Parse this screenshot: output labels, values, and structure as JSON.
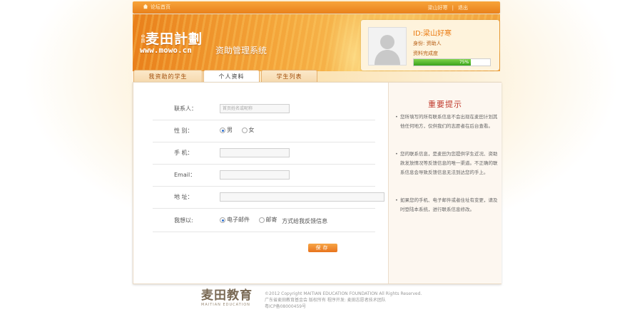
{
  "topbar": {
    "home_label": "论坛首页",
    "username": "梁山好寒",
    "separator": "|",
    "logout_label": "退出"
  },
  "banner": {
    "logo_small": "中国",
    "logo_name": "麦田計劃",
    "logo_url": "www.mowo.cn",
    "system_title": "资助管理系统"
  },
  "profile": {
    "id_text": "ID:梁山好寒",
    "role_text": "身份: 资助人",
    "completeness_label": "资料完成度",
    "completeness_percent": 75,
    "completeness_text": "75%"
  },
  "tabs": [
    {
      "label": "我资助的学生",
      "active": false
    },
    {
      "label": "个人资料",
      "active": true
    },
    {
      "label": "学生列表",
      "active": false
    }
  ],
  "form": {
    "contact_label": "联系人：",
    "contact_placeholder": "首页姓名或昵称",
    "gender_label": "性  别：",
    "gender_male": "男",
    "gender_female": "女",
    "phone_label": "手  机：",
    "email_label": "Email：",
    "address_label": "地  址：",
    "pref_label": "我想以:",
    "pref_email": "电子邮件",
    "pref_post": "邮寄",
    "pref_suffix": "方式给我反馈信息",
    "save_label": "保存"
  },
  "notice": {
    "title": "重要提示",
    "tips": [
      "您所填写的所有联系信息不会出现在麦田计划其他任何地方，仅供我们的志愿者在后台查看。",
      "您的联系信息，是麦田为您提供学生近况、资助款发放情况等反馈信息的唯一渠道。不正确的联系信息会导致反馈信息无法到达您的手上。",
      "如果您的手机、电子邮件或者住址有变更，请及时登陆本系统，进行联系信息修改。"
    ]
  },
  "footer": {
    "logo_cn": "麦田教育",
    "logo_en": "MAITIAN EDUCATION",
    "copyright": "©2012 Copyright MAITIAN EDUCATION FOUNDATION All Rights Reserved.",
    "rights": "广东省麦田教育基金会 版权所有  程序开发: 麦田志愿者技术团队",
    "icp": "粤ICP备08000459号"
  },
  "colors": {
    "accent": "#e9811b",
    "progress": "#3aa31d",
    "notice_title": "#c0392b"
  }
}
